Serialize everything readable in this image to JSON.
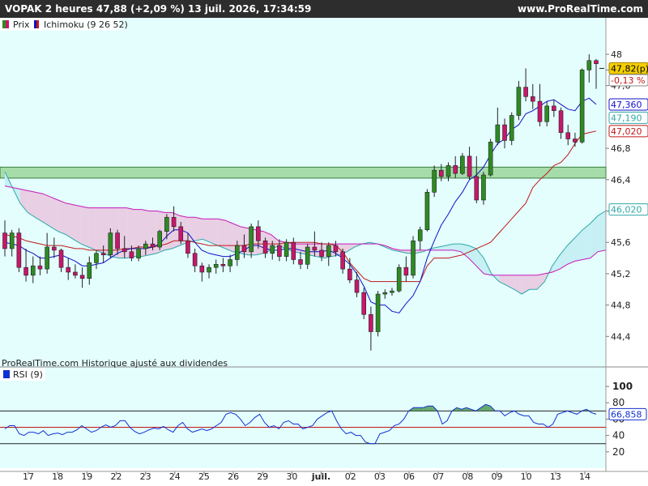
{
  "header": {
    "title": "VOPAK 2 heures 47,88 (+2,09 %) 13 juil. 2026, 17:34:59",
    "site": "www.ProRealTime.com"
  },
  "legend": {
    "price": "Prix",
    "ichimoku": "Ichimoku (9 26 52)",
    "rsi": "RSI (9)"
  },
  "watermark": "ProRealTime.com  Historique ajusté aux dividendes",
  "colors": {
    "background": "#e4fefe",
    "up": "#2e8b22",
    "down": "#c8166a",
    "tenkan": "#1010c8",
    "kijun": "#c01818",
    "spanA": "#30a8a8",
    "spanB": "#c818b8",
    "cloud": "#e8cfe4",
    "zone": "#a6dcaa",
    "rsi": "#1030d0"
  },
  "chart_data": [
    {
      "type": "candlestick",
      "x": [
        "17",
        "18",
        "19",
        "22",
        "23",
        "24",
        "25",
        "26",
        "29",
        "30",
        "juil.",
        "02",
        "03",
        "06",
        "07",
        "08",
        "09",
        "10",
        "13",
        "14"
      ],
      "y_ticks": [
        48,
        47.8,
        47.6,
        46.8,
        46.4,
        46.0,
        45.6,
        45.2,
        44.8,
        44.4
      ],
      "y_tick_labels": [
        "48",
        "47,8",
        "47,6",
        "46,8",
        "46,4",
        "46",
        "45,6",
        "45,2",
        "44,8",
        "44,4"
      ],
      "ylim": [
        44.0,
        48.3
      ],
      "badges": [
        {
          "label": "47,82(p)",
          "value": 47.82,
          "fill": "#f5d000",
          "border": "#a08000",
          "color": "#000000"
        },
        {
          "label": "-0,13 %",
          "value": 47.67,
          "fill": "#ffffff",
          "border": "#888888",
          "color": "#c01818"
        },
        {
          "label": "47,360",
          "value": 47.36,
          "fill": "#ffffff",
          "border": "#1010c8",
          "color": "#1010c8"
        },
        {
          "label": "47,190",
          "value": 47.19,
          "fill": "#ffffff",
          "border": "#30a8a8",
          "color": "#30a8a8"
        },
        {
          "label": "47,020",
          "value": 47.02,
          "fill": "#ffffff",
          "border": "#c01818",
          "color": "#c01818"
        },
        {
          "label": "46,020",
          "value": 46.02,
          "fill": "#ffffff",
          "border": "#30a8a8",
          "color": "#30a8a8"
        }
      ],
      "zone": [
        46.42,
        46.56
      ],
      "candles": [
        [
          45.72,
          45.88,
          45.42,
          45.52
        ],
        [
          45.52,
          45.76,
          45.42,
          45.72
        ],
        [
          45.72,
          45.78,
          45.22,
          45.28
        ],
        [
          45.28,
          45.52,
          45.1,
          45.18
        ],
        [
          45.18,
          45.42,
          45.08,
          45.3
        ],
        [
          45.3,
          45.42,
          45.18,
          45.26
        ],
        [
          45.26,
          45.72,
          45.2,
          45.54
        ],
        [
          45.54,
          45.66,
          45.4,
          45.5
        ],
        [
          45.5,
          45.52,
          45.22,
          45.28
        ],
        [
          45.28,
          45.4,
          45.12,
          45.22
        ],
        [
          45.22,
          45.32,
          45.14,
          45.18
        ],
        [
          45.18,
          45.28,
          45.02,
          45.14
        ],
        [
          45.14,
          45.42,
          45.06,
          45.34
        ],
        [
          45.34,
          45.5,
          45.26,
          45.46
        ],
        [
          45.46,
          45.56,
          45.34,
          45.44
        ],
        [
          45.44,
          45.78,
          45.4,
          45.72
        ],
        [
          45.72,
          45.76,
          45.44,
          45.52
        ],
        [
          45.52,
          45.68,
          45.4,
          45.48
        ],
        [
          45.48,
          45.56,
          45.36,
          45.4
        ],
        [
          45.4,
          45.56,
          45.36,
          45.52
        ],
        [
          45.52,
          45.62,
          45.44,
          45.58
        ],
        [
          45.58,
          45.66,
          45.5,
          45.54
        ],
        [
          45.54,
          45.76,
          45.5,
          45.74
        ],
        [
          45.74,
          45.96,
          45.64,
          45.92
        ],
        [
          45.92,
          46.06,
          45.74,
          45.8
        ],
        [
          45.8,
          45.86,
          45.58,
          45.62
        ],
        [
          45.62,
          45.72,
          45.4,
          45.46
        ],
        [
          45.46,
          45.52,
          45.22,
          45.3
        ],
        [
          45.3,
          45.34,
          45.1,
          45.22
        ],
        [
          45.22,
          45.32,
          45.14,
          45.28
        ],
        [
          45.28,
          45.38,
          45.2,
          45.32
        ],
        [
          45.32,
          45.4,
          45.22,
          45.3
        ],
        [
          45.3,
          45.44,
          45.22,
          45.38
        ],
        [
          45.38,
          45.62,
          45.3,
          45.56
        ],
        [
          45.56,
          45.7,
          45.4,
          45.48
        ],
        [
          45.48,
          45.84,
          45.4,
          45.8
        ],
        [
          45.8,
          45.88,
          45.52,
          45.62
        ],
        [
          45.62,
          45.66,
          45.4,
          45.46
        ],
        [
          45.46,
          45.62,
          45.38,
          45.56
        ],
        [
          45.56,
          45.64,
          45.36,
          45.42
        ],
        [
          45.42,
          45.64,
          45.36,
          45.6
        ],
        [
          45.6,
          45.66,
          45.32,
          45.38
        ],
        [
          45.38,
          45.48,
          45.26,
          45.32
        ],
        [
          45.32,
          45.58,
          45.26,
          45.54
        ],
        [
          45.54,
          45.74,
          45.42,
          45.5
        ],
        [
          45.5,
          45.6,
          45.36,
          45.42
        ],
        [
          45.42,
          45.6,
          45.3,
          45.56
        ],
        [
          45.56,
          45.62,
          45.42,
          45.48
        ],
        [
          45.48,
          45.52,
          45.2,
          45.26
        ],
        [
          45.26,
          45.4,
          45.08,
          45.12
        ],
        [
          45.12,
          45.22,
          44.9,
          44.96
        ],
        [
          44.96,
          45.02,
          44.62,
          44.68
        ],
        [
          44.68,
          44.78,
          44.22,
          44.46
        ],
        [
          44.46,
          44.98,
          44.4,
          44.94
        ],
        [
          44.94,
          45.0,
          44.88,
          44.96
        ],
        [
          44.96,
          45.02,
          44.92,
          44.98
        ],
        [
          44.98,
          45.32,
          44.96,
          45.28
        ],
        [
          45.28,
          45.42,
          45.1,
          45.18
        ],
        [
          45.18,
          45.68,
          45.14,
          45.62
        ],
        [
          45.62,
          45.8,
          45.5,
          45.76
        ],
        [
          45.76,
          46.28,
          45.74,
          46.24
        ],
        [
          46.24,
          46.58,
          46.18,
          46.52
        ],
        [
          46.52,
          46.6,
          46.38,
          46.44
        ],
        [
          46.44,
          46.62,
          46.38,
          46.58
        ],
        [
          46.58,
          46.7,
          46.42,
          46.48
        ],
        [
          46.48,
          46.74,
          46.46,
          46.7
        ],
        [
          46.7,
          46.82,
          46.4,
          46.44
        ],
        [
          46.44,
          46.7,
          46.1,
          46.14
        ],
        [
          46.14,
          46.5,
          46.08,
          46.46
        ],
        [
          46.46,
          46.92,
          46.44,
          46.88
        ],
        [
          46.88,
          47.32,
          46.84,
          47.1
        ],
        [
          47.1,
          47.18,
          46.8,
          46.9
        ],
        [
          46.9,
          47.26,
          46.84,
          47.22
        ],
        [
          47.22,
          47.66,
          47.16,
          47.58
        ],
        [
          47.58,
          47.82,
          47.4,
          47.46
        ],
        [
          47.46,
          47.62,
          47.3,
          47.4
        ],
        [
          47.4,
          47.62,
          47.08,
          47.14
        ],
        [
          47.14,
          47.4,
          47.08,
          47.34
        ],
        [
          47.34,
          47.42,
          47.2,
          47.28
        ],
        [
          47.28,
          47.32,
          46.92,
          47.0
        ],
        [
          47.0,
          47.1,
          46.84,
          46.92
        ],
        [
          46.92,
          47.0,
          46.82,
          46.88
        ],
        [
          46.88,
          47.82,
          46.86,
          47.8
        ],
        [
          47.8,
          48.0,
          47.64,
          47.92
        ],
        [
          47.92,
          47.94,
          47.56,
          47.88
        ]
      ],
      "tenkan": [
        45.6,
        45.58,
        45.56,
        45.5,
        45.46,
        45.4,
        45.4,
        45.42,
        45.44,
        45.4,
        45.36,
        45.3,
        45.3,
        45.32,
        45.34,
        45.4,
        45.46,
        45.5,
        45.52,
        45.52,
        45.52,
        45.54,
        45.58,
        45.68,
        45.76,
        45.76,
        45.72,
        45.6,
        45.5,
        45.46,
        45.44,
        45.42,
        45.42,
        45.46,
        45.5,
        45.56,
        45.56,
        45.52,
        45.5,
        45.5,
        45.52,
        45.52,
        45.5,
        45.48,
        45.48,
        45.48,
        45.5,
        45.46,
        45.4,
        45.32,
        45.2,
        45.04,
        44.84,
        44.8,
        44.8,
        44.72,
        44.7,
        44.82,
        44.92,
        45.1,
        45.4,
        45.62,
        45.82,
        45.96,
        46.12,
        46.24,
        46.4,
        46.46,
        46.56,
        46.72,
        46.86,
        46.92,
        47.04,
        47.1,
        47.24,
        47.28,
        47.34,
        47.4,
        47.42,
        47.36,
        47.3,
        47.28,
        47.4,
        47.44,
        47.36
      ],
      "kijun": [
        45.7,
        45.68,
        45.66,
        45.62,
        45.6,
        45.58,
        45.56,
        45.56,
        45.56,
        45.54,
        45.52,
        45.52,
        45.5,
        45.5,
        45.5,
        45.5,
        45.5,
        45.52,
        45.52,
        45.54,
        45.54,
        45.54,
        45.56,
        45.58,
        45.62,
        45.62,
        45.62,
        45.6,
        45.58,
        45.56,
        45.56,
        45.56,
        45.56,
        45.56,
        45.56,
        45.58,
        45.58,
        45.58,
        45.58,
        45.58,
        45.6,
        45.6,
        45.6,
        45.6,
        45.6,
        45.58,
        45.58,
        45.56,
        45.48,
        45.34,
        45.24,
        45.14,
        45.1,
        45.1,
        45.1,
        45.1,
        45.1,
        45.1,
        45.1,
        45.1,
        45.3,
        45.4,
        45.4,
        45.4,
        45.42,
        45.44,
        45.48,
        45.52,
        45.56,
        45.6,
        45.7,
        45.8,
        45.9,
        46.0,
        46.1,
        46.3,
        46.4,
        46.48,
        46.58,
        46.62,
        46.72,
        46.86,
        46.98,
        47.0,
        47.02
      ],
      "spanA_start": 0,
      "spanA": [
        46.5,
        46.3,
        46.1,
        45.98,
        45.92,
        45.86,
        45.8,
        45.74,
        45.7,
        45.64,
        45.58,
        45.54,
        45.5,
        45.46,
        45.42,
        45.4,
        45.4,
        45.42,
        45.42,
        45.44,
        45.46,
        45.5,
        45.52,
        45.56,
        45.6,
        45.62,
        45.64,
        45.6,
        45.56,
        45.52,
        45.48,
        45.46,
        45.44,
        45.44,
        45.46,
        45.5,
        45.56,
        45.52,
        45.48,
        45.46,
        45.44,
        45.42,
        45.4,
        45.42,
        45.44,
        45.48,
        45.54,
        45.58,
        45.6,
        45.58,
        45.54,
        45.5,
        45.48,
        45.46,
        45.46,
        45.48,
        45.52,
        45.54,
        45.56,
        45.58,
        45.58,
        45.56,
        45.52,
        45.4,
        45.2,
        45.1,
        45.05,
        45.0,
        44.94,
        45.0,
        45.0,
        45.1,
        45.3,
        45.44,
        45.56,
        45.66,
        45.76,
        45.84,
        45.94,
        46.0
      ],
      "spanB_start": 0,
      "spanB": [
        46.32,
        46.3,
        46.28,
        46.26,
        46.24,
        46.22,
        46.18,
        46.14,
        46.1,
        46.08,
        46.06,
        46.04,
        46.04,
        46.04,
        46.04,
        46.04,
        46.04,
        46.02,
        46.02,
        46.0,
        46.0,
        45.98,
        45.98,
        45.94,
        45.92,
        45.92,
        45.9,
        45.9,
        45.9,
        45.88,
        45.84,
        45.8,
        45.78,
        45.76,
        45.74,
        45.7,
        45.62,
        45.6,
        45.58,
        45.58,
        45.58,
        45.58,
        45.58,
        45.58,
        45.58,
        45.58,
        45.58,
        45.58,
        45.58,
        45.58,
        45.56,
        45.52,
        45.5,
        45.5,
        45.5,
        45.5,
        45.5,
        45.5,
        45.5,
        45.5,
        45.48,
        45.4,
        45.3,
        45.2,
        45.18,
        45.18,
        45.18,
        45.18,
        45.18,
        45.18,
        45.18,
        45.2,
        45.22,
        45.26,
        45.32,
        45.36,
        45.38,
        45.4,
        45.48,
        45.5
      ]
    },
    {
      "type": "line",
      "name": "RSI (9)",
      "y_ticks": [
        100,
        80,
        60,
        40,
        20
      ],
      "ylim": [
        0,
        105
      ],
      "levels": [
        70,
        50,
        30
      ],
      "last_label": "66,858",
      "values": [
        48,
        52,
        52,
        42,
        40,
        44,
        44,
        42,
        46,
        40,
        42,
        43,
        41,
        44,
        44,
        47,
        52,
        48,
        44,
        46,
        50,
        53,
        50,
        52,
        58,
        58,
        50,
        45,
        42,
        44,
        47,
        49,
        48,
        51,
        47,
        44,
        52,
        56,
        48,
        44,
        46,
        48,
        46,
        48,
        52,
        56,
        66,
        68,
        66,
        60,
        52,
        56,
        62,
        66,
        56,
        50,
        52,
        48,
        56,
        58,
        54,
        54,
        48,
        50,
        52,
        60,
        64,
        68,
        70,
        58,
        48,
        42,
        44,
        40,
        40,
        32,
        30,
        30,
        42,
        44,
        46,
        52,
        54,
        60,
        70,
        74,
        74,
        74,
        76,
        76,
        70,
        54,
        58,
        70,
        74,
        72,
        74,
        72,
        70,
        74,
        78,
        76,
        70,
        70,
        64,
        68,
        70,
        66,
        64,
        64,
        56,
        54,
        54,
        50,
        54,
        66,
        68,
        70,
        68,
        66,
        70,
        72,
        68,
        66
      ]
    }
  ]
}
